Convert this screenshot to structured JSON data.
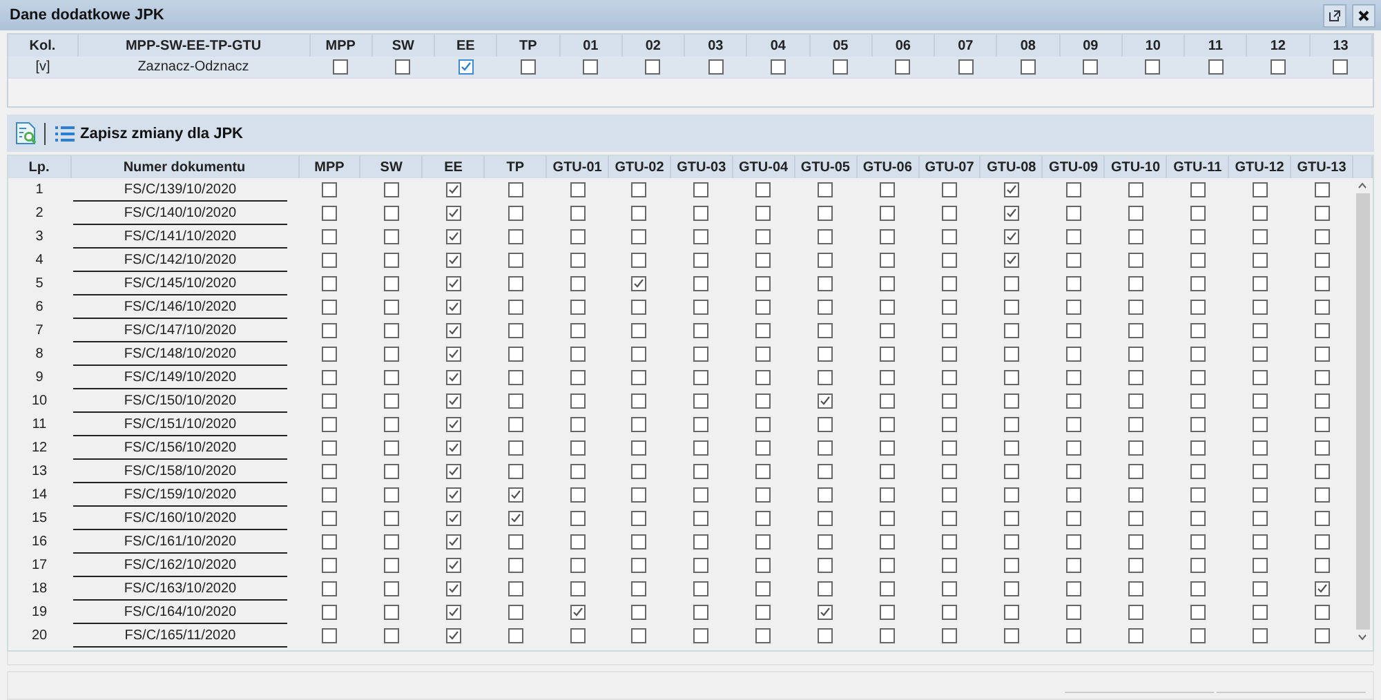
{
  "window": {
    "title": "Dane dodatkowe JPK"
  },
  "filter": {
    "columns": [
      "Kol.",
      "MPP-SW-EE-TP-GTU",
      "MPP",
      "SW",
      "EE",
      "TP",
      "01",
      "02",
      "03",
      "04",
      "05",
      "06",
      "07",
      "08",
      "09",
      "10",
      "11",
      "12",
      "13"
    ],
    "row": {
      "col": "[v]",
      "label": "Zaznacz-Odznacz",
      "checks": [
        false,
        false,
        true,
        false,
        false,
        false,
        false,
        false,
        false,
        false,
        false,
        false,
        false,
        false,
        false,
        false,
        false
      ]
    }
  },
  "toolbar": {
    "save_button": "Zapisz zmiany dla JPK"
  },
  "table": {
    "columns": [
      "Lp.",
      "Numer dokumentu",
      "MPP",
      "SW",
      "EE",
      "TP",
      "GTU-01",
      "GTU-02",
      "GTU-03",
      "GTU-04",
      "GTU-05",
      "GTU-06",
      "GTU-07",
      "GTU-08",
      "GTU-09",
      "GTU-10",
      "GTU-11",
      "GTU-12",
      "GTU-13"
    ],
    "rows": [
      {
        "lp": "1",
        "doc": "FS/C/139/10/2020",
        "checks": [
          false,
          false,
          true,
          false,
          false,
          false,
          false,
          false,
          false,
          false,
          false,
          true,
          false,
          false,
          false,
          false,
          false
        ]
      },
      {
        "lp": "2",
        "doc": "FS/C/140/10/2020",
        "checks": [
          false,
          false,
          true,
          false,
          false,
          false,
          false,
          false,
          false,
          false,
          false,
          true,
          false,
          false,
          false,
          false,
          false
        ]
      },
      {
        "lp": "3",
        "doc": "FS/C/141/10/2020",
        "checks": [
          false,
          false,
          true,
          false,
          false,
          false,
          false,
          false,
          false,
          false,
          false,
          true,
          false,
          false,
          false,
          false,
          false
        ]
      },
      {
        "lp": "4",
        "doc": "FS/C/142/10/2020",
        "checks": [
          false,
          false,
          true,
          false,
          false,
          false,
          false,
          false,
          false,
          false,
          false,
          true,
          false,
          false,
          false,
          false,
          false
        ]
      },
      {
        "lp": "5",
        "doc": "FS/C/145/10/2020",
        "checks": [
          false,
          false,
          true,
          false,
          false,
          true,
          false,
          false,
          false,
          false,
          false,
          false,
          false,
          false,
          false,
          false,
          false
        ]
      },
      {
        "lp": "6",
        "doc": "FS/C/146/10/2020",
        "checks": [
          false,
          false,
          true,
          false,
          false,
          false,
          false,
          false,
          false,
          false,
          false,
          false,
          false,
          false,
          false,
          false,
          false
        ]
      },
      {
        "lp": "7",
        "doc": "FS/C/147/10/2020",
        "checks": [
          false,
          false,
          true,
          false,
          false,
          false,
          false,
          false,
          false,
          false,
          false,
          false,
          false,
          false,
          false,
          false,
          false
        ]
      },
      {
        "lp": "8",
        "doc": "FS/C/148/10/2020",
        "checks": [
          false,
          false,
          true,
          false,
          false,
          false,
          false,
          false,
          false,
          false,
          false,
          false,
          false,
          false,
          false,
          false,
          false
        ]
      },
      {
        "lp": "9",
        "doc": "FS/C/149/10/2020",
        "checks": [
          false,
          false,
          true,
          false,
          false,
          false,
          false,
          false,
          false,
          false,
          false,
          false,
          false,
          false,
          false,
          false,
          false
        ]
      },
      {
        "lp": "10",
        "doc": "FS/C/150/10/2020",
        "checks": [
          false,
          false,
          true,
          false,
          false,
          false,
          false,
          false,
          true,
          false,
          false,
          false,
          false,
          false,
          false,
          false,
          false
        ]
      },
      {
        "lp": "11",
        "doc": "FS/C/151/10/2020",
        "checks": [
          false,
          false,
          true,
          false,
          false,
          false,
          false,
          false,
          false,
          false,
          false,
          false,
          false,
          false,
          false,
          false,
          false
        ]
      },
      {
        "lp": "12",
        "doc": "FS/C/156/10/2020",
        "checks": [
          false,
          false,
          true,
          false,
          false,
          false,
          false,
          false,
          false,
          false,
          false,
          false,
          false,
          false,
          false,
          false,
          false
        ]
      },
      {
        "lp": "13",
        "doc": "FS/C/158/10/2020",
        "checks": [
          false,
          false,
          true,
          false,
          false,
          false,
          false,
          false,
          false,
          false,
          false,
          false,
          false,
          false,
          false,
          false,
          false
        ]
      },
      {
        "lp": "14",
        "doc": "FS/C/159/10/2020",
        "checks": [
          false,
          false,
          true,
          true,
          false,
          false,
          false,
          false,
          false,
          false,
          false,
          false,
          false,
          false,
          false,
          false,
          false
        ]
      },
      {
        "lp": "15",
        "doc": "FS/C/160/10/2020",
        "checks": [
          false,
          false,
          true,
          true,
          false,
          false,
          false,
          false,
          false,
          false,
          false,
          false,
          false,
          false,
          false,
          false,
          false
        ]
      },
      {
        "lp": "16",
        "doc": "FS/C/161/10/2020",
        "checks": [
          false,
          false,
          true,
          false,
          false,
          false,
          false,
          false,
          false,
          false,
          false,
          false,
          false,
          false,
          false,
          false,
          false
        ]
      },
      {
        "lp": "17",
        "doc": "FS/C/162/10/2020",
        "checks": [
          false,
          false,
          true,
          false,
          false,
          false,
          false,
          false,
          false,
          false,
          false,
          false,
          false,
          false,
          false,
          false,
          false
        ]
      },
      {
        "lp": "18",
        "doc": "FS/C/163/10/2020",
        "checks": [
          false,
          false,
          true,
          false,
          false,
          false,
          false,
          false,
          false,
          false,
          false,
          false,
          false,
          false,
          false,
          false,
          true
        ]
      },
      {
        "lp": "19",
        "doc": "FS/C/164/10/2020",
        "checks": [
          false,
          false,
          true,
          false,
          true,
          false,
          false,
          false,
          true,
          false,
          false,
          false,
          false,
          false,
          false,
          false,
          false
        ]
      },
      {
        "lp": "20",
        "doc": "FS/C/165/11/2020",
        "checks": [
          false,
          false,
          true,
          false,
          false,
          false,
          false,
          false,
          false,
          false,
          false,
          false,
          false,
          false,
          false,
          false,
          false
        ]
      }
    ]
  }
}
